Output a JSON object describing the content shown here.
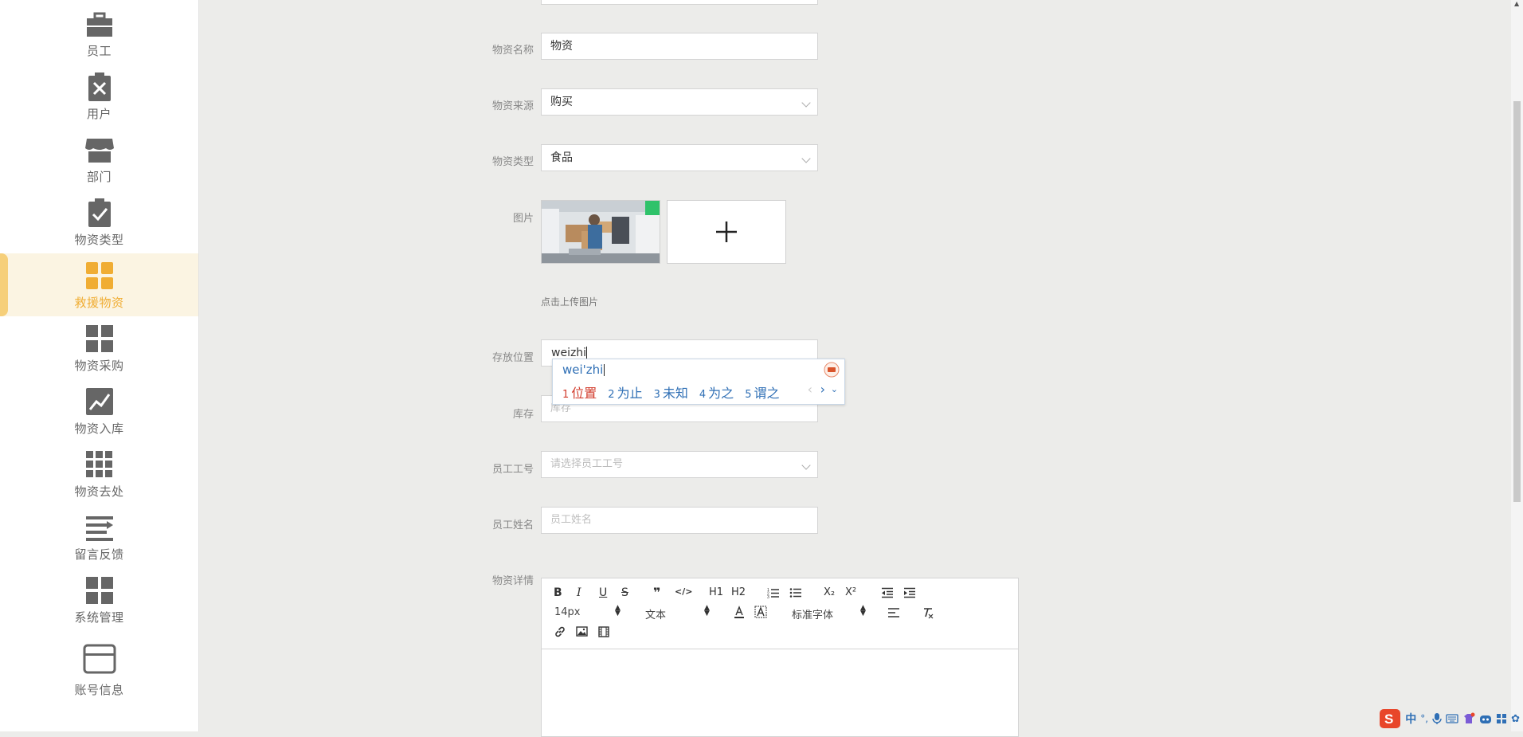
{
  "sidebar": {
    "items": [
      {
        "label": "员工",
        "icon": "briefcase-icon"
      },
      {
        "label": "用户",
        "icon": "clipboard-x-icon"
      },
      {
        "label": "部门",
        "icon": "storefront-icon"
      },
      {
        "label": "物资类型",
        "icon": "clipboard-check-icon"
      },
      {
        "label": "救援物资",
        "icon": "grid-icon",
        "active": true
      },
      {
        "label": "物资采购",
        "icon": "grid-icon"
      },
      {
        "label": "物资入库",
        "icon": "chart-line-icon"
      },
      {
        "label": "物资去处",
        "icon": "apps-icon"
      },
      {
        "label": "留言反馈",
        "icon": "list-icon"
      },
      {
        "label": "系统管理",
        "icon": "grid-icon"
      },
      {
        "label": "账号信息",
        "icon": "card-icon"
      }
    ],
    "active_color": "#f0ad33"
  },
  "form": {
    "name": {
      "label": "物资名称",
      "value": "物资"
    },
    "source": {
      "label": "物资来源",
      "value": "购买"
    },
    "type": {
      "label": "物资类型",
      "value": "食品"
    },
    "image": {
      "label": "图片",
      "upload_hint": "点击上传图片",
      "upload_icon": "plus-icon"
    },
    "location": {
      "label": "存放位置",
      "value": "weizhi"
    },
    "stock": {
      "label": "库存",
      "placeholder": "库存"
    },
    "staff_id": {
      "label": "员工工号",
      "placeholder": "请选择员工工号"
    },
    "staff_name": {
      "label": "员工姓名",
      "placeholder": "员工姓名"
    },
    "details": {
      "label": "物资详情"
    }
  },
  "ime": {
    "pinyin": "wei'zhi",
    "candidates": [
      {
        "n": "1",
        "text": "位置"
      },
      {
        "n": "2",
        "text": "为止"
      },
      {
        "n": "3",
        "text": "未知"
      },
      {
        "n": "4",
        "text": "为之"
      },
      {
        "n": "5",
        "text": "谓之"
      }
    ]
  },
  "editor": {
    "toolbar_row1": [
      "B",
      "I",
      "U",
      "S",
      "❞",
      "</>",
      "H1",
      "H2",
      "ordered-list-icon",
      "bullet-list-icon",
      "X₂",
      "X²",
      "outdent-icon",
      "indent-icon"
    ],
    "font_size": "14px",
    "block_type": "文本",
    "font_family": "标准字体"
  },
  "colors": {
    "accent": "#f0ad33",
    "ime_blue": "#2f6fb5",
    "ime_red": "#d23b2b"
  }
}
